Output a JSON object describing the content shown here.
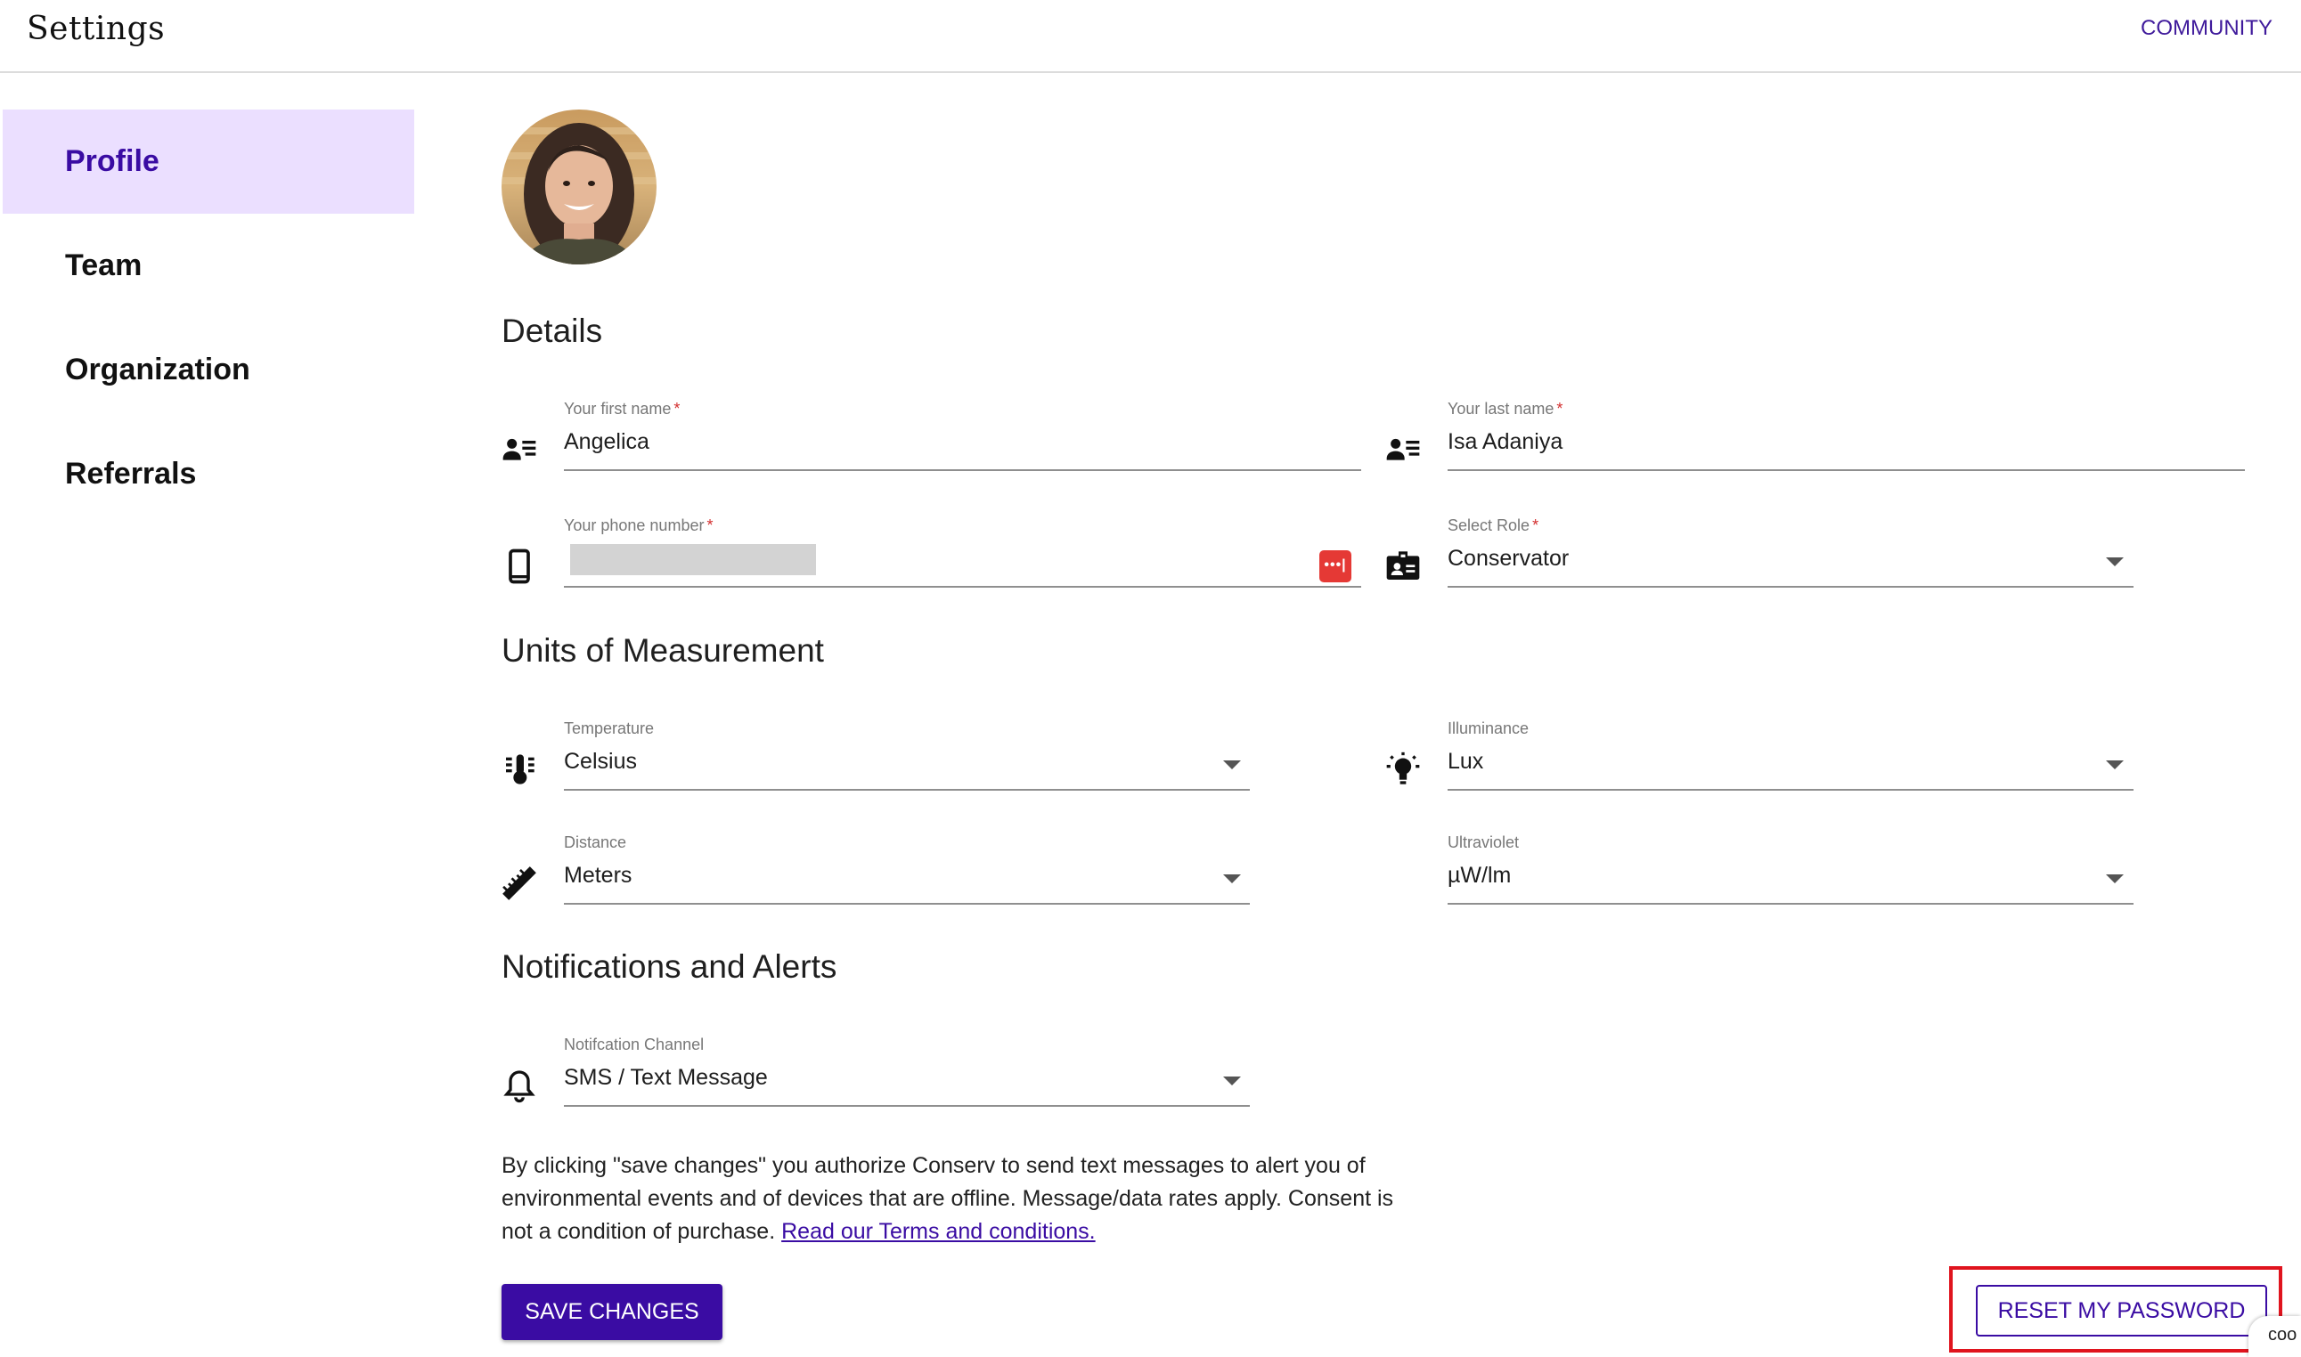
{
  "header": {
    "title": "Settings",
    "community_link": "COMMUNITY"
  },
  "sidebar": {
    "items": [
      {
        "label": "Profile",
        "active": true
      },
      {
        "label": "Team",
        "active": false
      },
      {
        "label": "Organization",
        "active": false
      },
      {
        "label": "Referrals",
        "active": false
      }
    ]
  },
  "details": {
    "title": "Details",
    "first_name": {
      "label": "Your first name",
      "required": "*",
      "value": "Angelica"
    },
    "last_name": {
      "label": "Your last name",
      "required": "*",
      "value": "Isa Adaniya"
    },
    "phone": {
      "label": "Your phone number",
      "required": "*",
      "value": "",
      "badge": "•••|"
    },
    "role": {
      "label": "Select Role",
      "required": "*",
      "value": "Conservator"
    }
  },
  "units": {
    "title": "Units of Measurement",
    "temperature": {
      "label": "Temperature",
      "value": "Celsius"
    },
    "illuminance": {
      "label": "Illuminance",
      "value": "Lux"
    },
    "distance": {
      "label": "Distance",
      "value": "Meters"
    },
    "ultraviolet": {
      "label": "Ultraviolet",
      "value": "µW/lm"
    }
  },
  "notifications": {
    "title": "Notifications and Alerts",
    "channel": {
      "label": "Notifcation Channel",
      "value": "SMS / Text Message"
    }
  },
  "consent": {
    "text": "By clicking \"save changes\" you authorize Conserv to send text messages to alert you of environmental events and of devices that are offline. Message/data rates apply. Consent is not a condition of purchase. ",
    "link": "Read our Terms and conditions."
  },
  "actions": {
    "save_label": "SAVE CHANGES",
    "reset_label": "RESET MY PASSWORD"
  },
  "corner_chip": {
    "text": "coo"
  },
  "colors": {
    "accent": "#3a0ca3",
    "active_bg": "#ebdfff",
    "highlight": "#e0141e"
  }
}
